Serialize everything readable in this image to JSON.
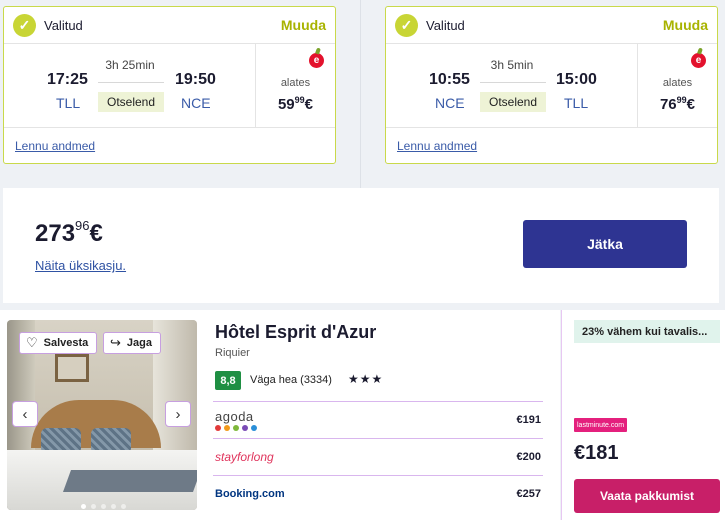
{
  "outbound": {
    "status": "Valitud",
    "change_label": "Muuda",
    "depart_time": "17:25",
    "arrive_time": "19:50",
    "depart_code": "TLL",
    "arrive_code": "NCE",
    "duration": "3h 25min",
    "stops": "Otselend",
    "from_label": "alates",
    "price_main": "59",
    "price_cents": "99",
    "price_currency": "€",
    "details_link": "Lennu andmed",
    "airline_icon": "airbaltic-cherry-logo-icon"
  },
  "inbound": {
    "status": "Valitud",
    "change_label": "Muuda",
    "depart_time": "10:55",
    "arrive_time": "15:00",
    "depart_code": "NCE",
    "arrive_code": "TLL",
    "duration": "3h 5min",
    "stops": "Otselend",
    "from_label": "alates",
    "price_main": "76",
    "price_cents": "99",
    "price_currency": "€",
    "details_link": "Lennu andmed",
    "airline_icon": "airbaltic-cherry-logo-icon"
  },
  "summary": {
    "total_main": "273",
    "total_cents": "96",
    "total_currency": "€",
    "per_person_link": "Näita üksikasju.",
    "continue_button": "Jätka"
  },
  "hotel": {
    "save_label": "Salvesta",
    "share_label": "Jaga",
    "name": "Hôtel Esprit d'Azur",
    "area": "Riquier",
    "score": "8,8",
    "rating_text": "Väga hea (3334)",
    "stars": "★★★",
    "photo_count": 5,
    "active_photo": 1,
    "offers": [
      {
        "provider": "agoda",
        "price": "€191"
      },
      {
        "provider": "stayforlong",
        "price": "€200"
      },
      {
        "provider": "Booking.com",
        "price": "€257"
      }
    ],
    "deal": {
      "banner": "23% vähem kui tavalis...",
      "provider_badge": "lastminute.com",
      "price": "€181",
      "button": "Vaata pakkumist"
    }
  },
  "colors": {
    "accent_lime": "#c8d535",
    "primary_blue": "#2e3492",
    "deal_pink": "#c81f68",
    "score_green": "#1f8f43",
    "link_blue": "#3a5ba8"
  }
}
